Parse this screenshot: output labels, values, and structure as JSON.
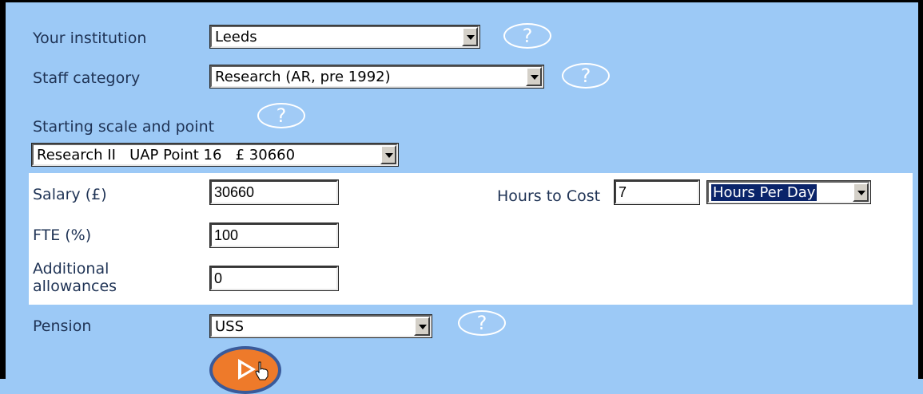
{
  "fields": {
    "institution": {
      "label": "Your institution",
      "value": "Leeds"
    },
    "staff_category": {
      "label": "Staff category",
      "value": "Research (AR, pre 1992)"
    },
    "starting_scale": {
      "label": "Starting scale and point",
      "value": "Research II   UAP Point 16   £ 30660"
    },
    "salary": {
      "label": "Salary (£)",
      "value": "30660"
    },
    "hours_to_cost": {
      "label": "Hours to Cost",
      "value": "7",
      "unit": "Hours Per Day"
    },
    "fte": {
      "label": "FTE (%)",
      "value": "100"
    },
    "allowances": {
      "label": "Additional allowances",
      "value": "0"
    },
    "pension": {
      "label": "Pension",
      "value": "USS"
    }
  },
  "help_glyph": "?",
  "icons": {
    "help": "help-icon",
    "go": "play-arrow-icon",
    "cursor": "hand-pointer-icon"
  },
  "colors": {
    "background": "#9cc9f6",
    "label_text": "#1f3355",
    "button_orange": "#ee7a2a",
    "highlight": "#0a246a"
  }
}
